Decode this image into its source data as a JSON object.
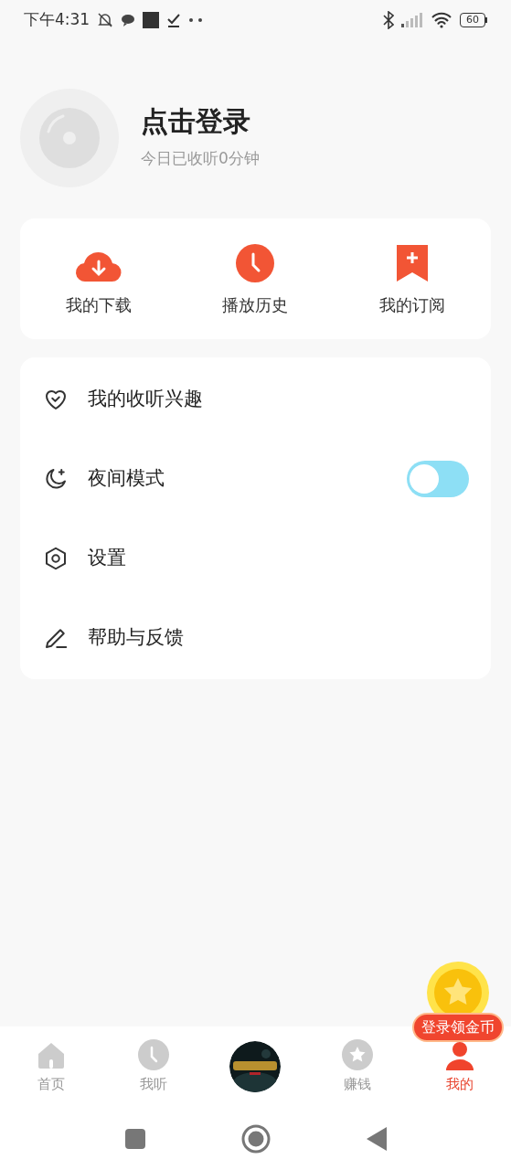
{
  "status_bar": {
    "time": "下午4:31",
    "battery": "60"
  },
  "profile": {
    "name": "点击登录",
    "subtitle": "今日已收听0分钟"
  },
  "shortcuts": [
    {
      "kind": "download",
      "label": "我的下载"
    },
    {
      "kind": "history",
      "label": "播放历史"
    },
    {
      "kind": "subscribe",
      "label": "我的订阅"
    }
  ],
  "menu": [
    {
      "kind": "interest",
      "label": "我的收听兴趣"
    },
    {
      "kind": "night",
      "label": "夜间模式",
      "on": false
    },
    {
      "kind": "settings",
      "label": "设置"
    },
    {
      "kind": "help",
      "label": "帮助与反馈"
    }
  ],
  "coin_badge": {
    "label": "登录领金币"
  },
  "tabs": [
    {
      "kind": "home",
      "label": "首页",
      "selected": false
    },
    {
      "kind": "listen",
      "label": "我听",
      "selected": false
    },
    {
      "kind": "picture"
    },
    {
      "kind": "earn",
      "label": "赚钱",
      "selected": false
    },
    {
      "kind": "mine",
      "label": "我的",
      "selected": true
    }
  ]
}
